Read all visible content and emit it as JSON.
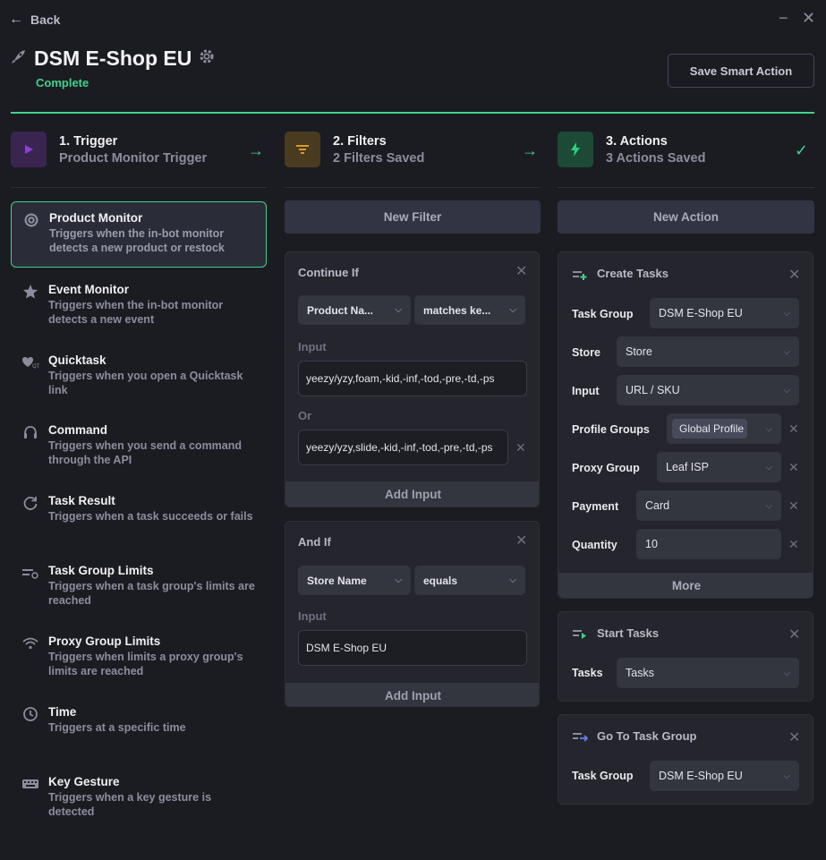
{
  "window": {
    "minimize": "−",
    "close": "✕"
  },
  "header": {
    "back_label": "Back",
    "title": "DSM E-Shop EU",
    "status": "Complete",
    "save_label": "Save Smart Action"
  },
  "steps": [
    {
      "title": "1. Trigger",
      "subtitle": "Product Monitor Trigger"
    },
    {
      "title": "2. Filters",
      "subtitle": "2 Filters Saved"
    },
    {
      "title": "3. Actions",
      "subtitle": "3 Actions Saved"
    }
  ],
  "triggers": [
    {
      "name": "Product Monitor",
      "desc": "Triggers when the in-bot monitor detects a new product or restock"
    },
    {
      "name": "Event Monitor",
      "desc": "Triggers when the in-bot monitor detects a new event"
    },
    {
      "name": "Quicktask",
      "desc": "Triggers when you open a Quicktask link"
    },
    {
      "name": "Command",
      "desc": "Triggers when you send a command through the API"
    },
    {
      "name": "Task Result",
      "desc": "Triggers when a task succeeds or fails"
    },
    {
      "name": "Task Group Limits",
      "desc": "Triggers when a task group's limits are reached"
    },
    {
      "name": "Proxy Group Limits",
      "desc": "Triggers when limits a proxy group's limits are reached"
    },
    {
      "name": "Time",
      "desc": "Triggers at a specific time"
    },
    {
      "name": "Key Gesture",
      "desc": "Triggers when a key gesture is detected"
    }
  ],
  "filters": {
    "new_label": "New Filter",
    "cards": [
      {
        "title": "Continue If",
        "field": "Product Na...",
        "operator": "matches ke...",
        "input_label": "Input",
        "input_value": "yeezy/yzy,foam,-kid,-inf,-tod,-pre,-td,-ps",
        "or_label": "Or",
        "or_value": "yeezy/yzy,slide,-kid,-inf,-tod,-pre,-td,-ps",
        "add_label": "Add Input"
      },
      {
        "title": "And If",
        "field": "Store Name",
        "operator": "equals",
        "input_label": "Input",
        "input_value": "DSM E-Shop EU",
        "add_label": "Add Input"
      }
    ]
  },
  "actions": {
    "new_label": "New Action",
    "create": {
      "title": "Create Tasks",
      "task_group_label": "Task Group",
      "task_group_value": "DSM E-Shop EU",
      "store_label": "Store",
      "store_value": "Store",
      "input_label": "Input",
      "input_value": "URL / SKU",
      "profile_label": "Profile Groups",
      "profile_value": "Global Profile",
      "proxy_label": "Proxy Group",
      "proxy_value": "Leaf ISP",
      "payment_label": "Payment",
      "payment_value": "Card",
      "quantity_label": "Quantity",
      "quantity_value": "10",
      "more_label": "More"
    },
    "start": {
      "title": "Start Tasks",
      "tasks_label": "Tasks",
      "tasks_value": "Tasks"
    },
    "goto": {
      "title": "Go To Task Group",
      "task_group_label": "Task Group",
      "task_group_value": "DSM E-Shop EU"
    }
  },
  "colors": {
    "accent_green": "#3ed38a",
    "trigger_purple": "#8b3fd6",
    "filter_amber": "#d79a2a",
    "action_green": "#2bd07f"
  }
}
